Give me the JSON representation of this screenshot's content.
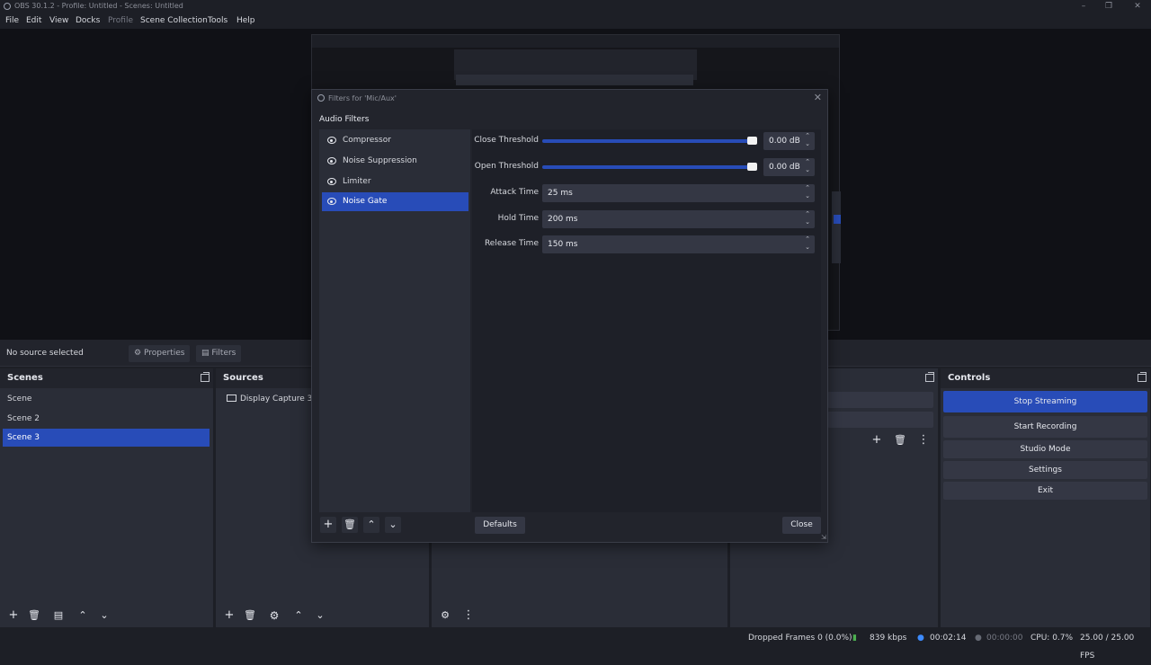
{
  "window": {
    "title": "OBS 30.1.2 - Profile: Untitled - Scenes: Untitled"
  },
  "menu": [
    "File",
    "Edit",
    "View",
    "Docks",
    "Profile",
    "Scene Collection",
    "Tools",
    "Help"
  ],
  "source_bar": {
    "status": "No source selected",
    "properties": "Properties",
    "filters": "Filters"
  },
  "scenes": {
    "title": "Scenes",
    "items": [
      "Scene",
      "Scene 2",
      "Scene 3"
    ],
    "selected": 2
  },
  "sources": {
    "title": "Sources",
    "items": [
      "Display Capture 3"
    ]
  },
  "controls": {
    "title": "Controls",
    "buttons": [
      "Stop Streaming",
      "Start Recording",
      "Studio Mode",
      "Settings",
      "Exit"
    ]
  },
  "status": {
    "dropped": "Dropped Frames 0 (0.0%)",
    "bitrate": "839 kbps",
    "stream_time": "00:02:14",
    "rec_time": "00:00:00",
    "cpu": "CPU: 0.7%",
    "fps": "25.00 / 25.00 FPS"
  },
  "dialog": {
    "title": "Filters for 'Mic/Aux'",
    "section": "Audio Filters",
    "filters": [
      "Compressor",
      "Noise Suppression",
      "Limiter",
      "Noise Gate"
    ],
    "selected": 3,
    "props": [
      {
        "label": "Close Threshold",
        "value": "0.00 dB",
        "slider": 1.0
      },
      {
        "label": "Open Threshold",
        "value": "0.00 dB",
        "slider": 1.0
      },
      {
        "label": "Attack Time",
        "value": "25 ms"
      },
      {
        "label": "Hold Time",
        "value": "200 ms"
      },
      {
        "label": "Release Time",
        "value": "150 ms"
      }
    ],
    "defaults": "Defaults",
    "close": "Close"
  },
  "colors": {
    "accent": "#284cb8",
    "panel": "#2a2d37",
    "bg": "#1d1f26"
  }
}
